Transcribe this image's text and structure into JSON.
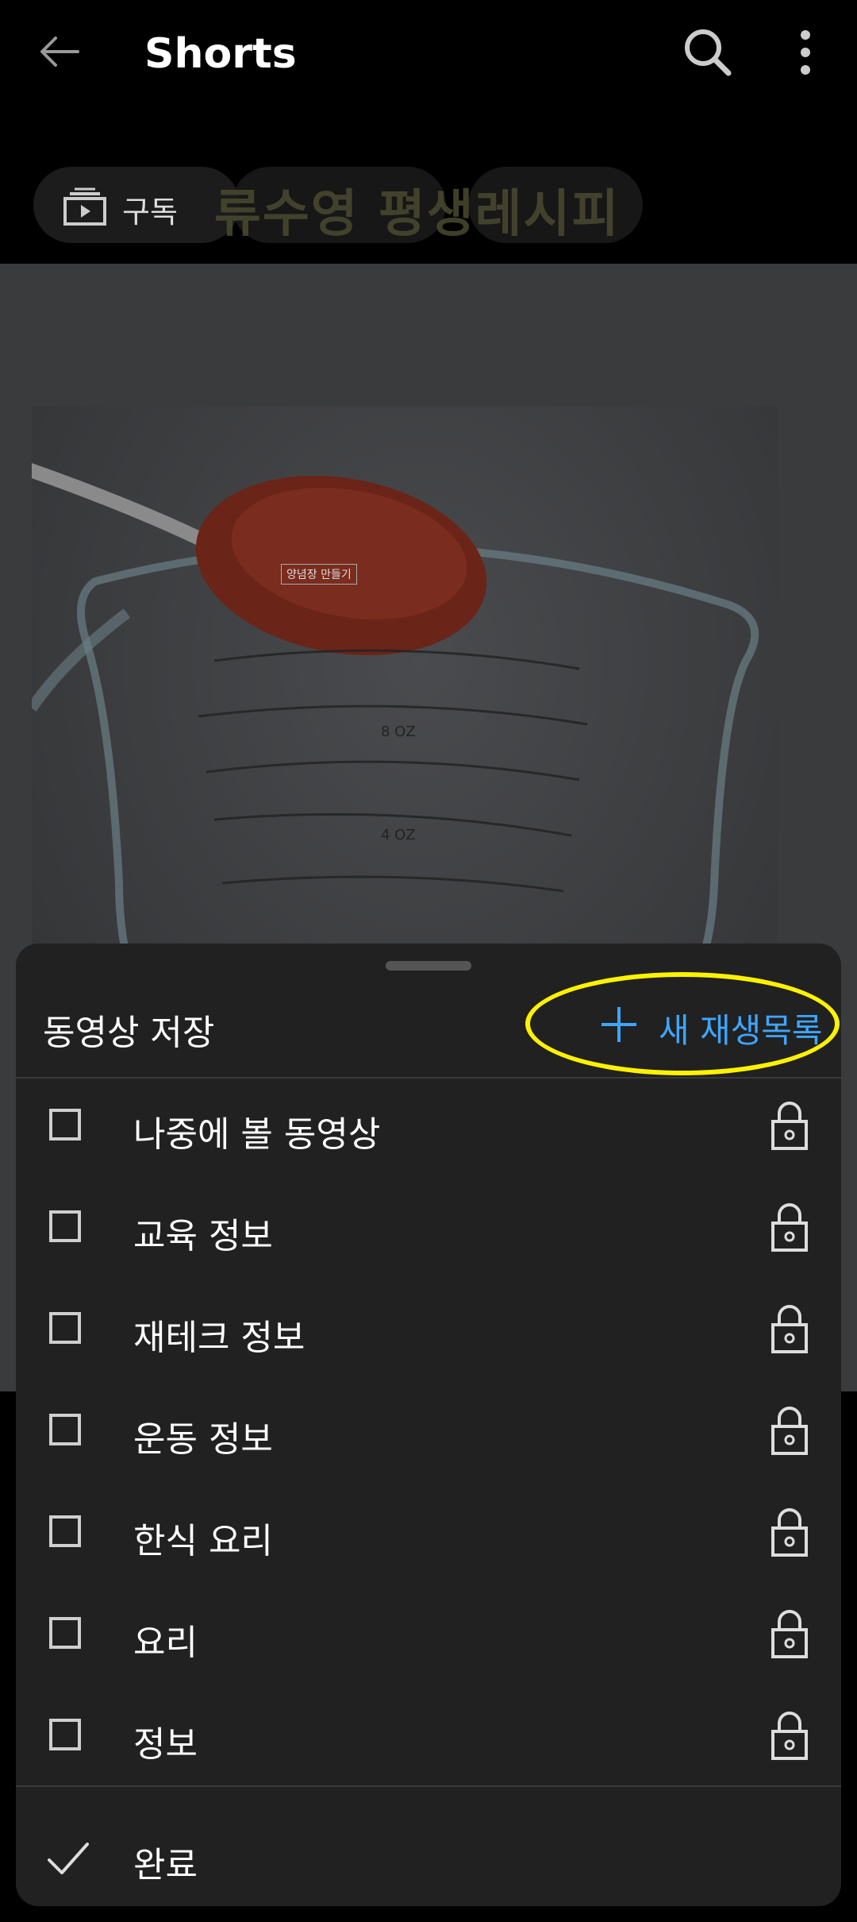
{
  "topbar": {
    "title": "Shorts"
  },
  "chip": {
    "subscribe_label": "구독"
  },
  "overlay": {
    "title": "류수영 평생레시피",
    "video_tag": "양념장 만들기"
  },
  "sheet": {
    "title": "동영상 저장",
    "new_playlist_label": "새 재생목록",
    "playlists": [
      {
        "label": "나중에 볼 동영상"
      },
      {
        "label": "교육 정보"
      },
      {
        "label": "재테크 정보"
      },
      {
        "label": "운동 정보"
      },
      {
        "label": "한식 요리"
      },
      {
        "label": "요리"
      },
      {
        "label": "정보"
      }
    ],
    "done_label": "완료"
  },
  "colors": {
    "accent": "#3ea6ff",
    "highlight": "#fff200",
    "sheet_bg": "#212121"
  }
}
